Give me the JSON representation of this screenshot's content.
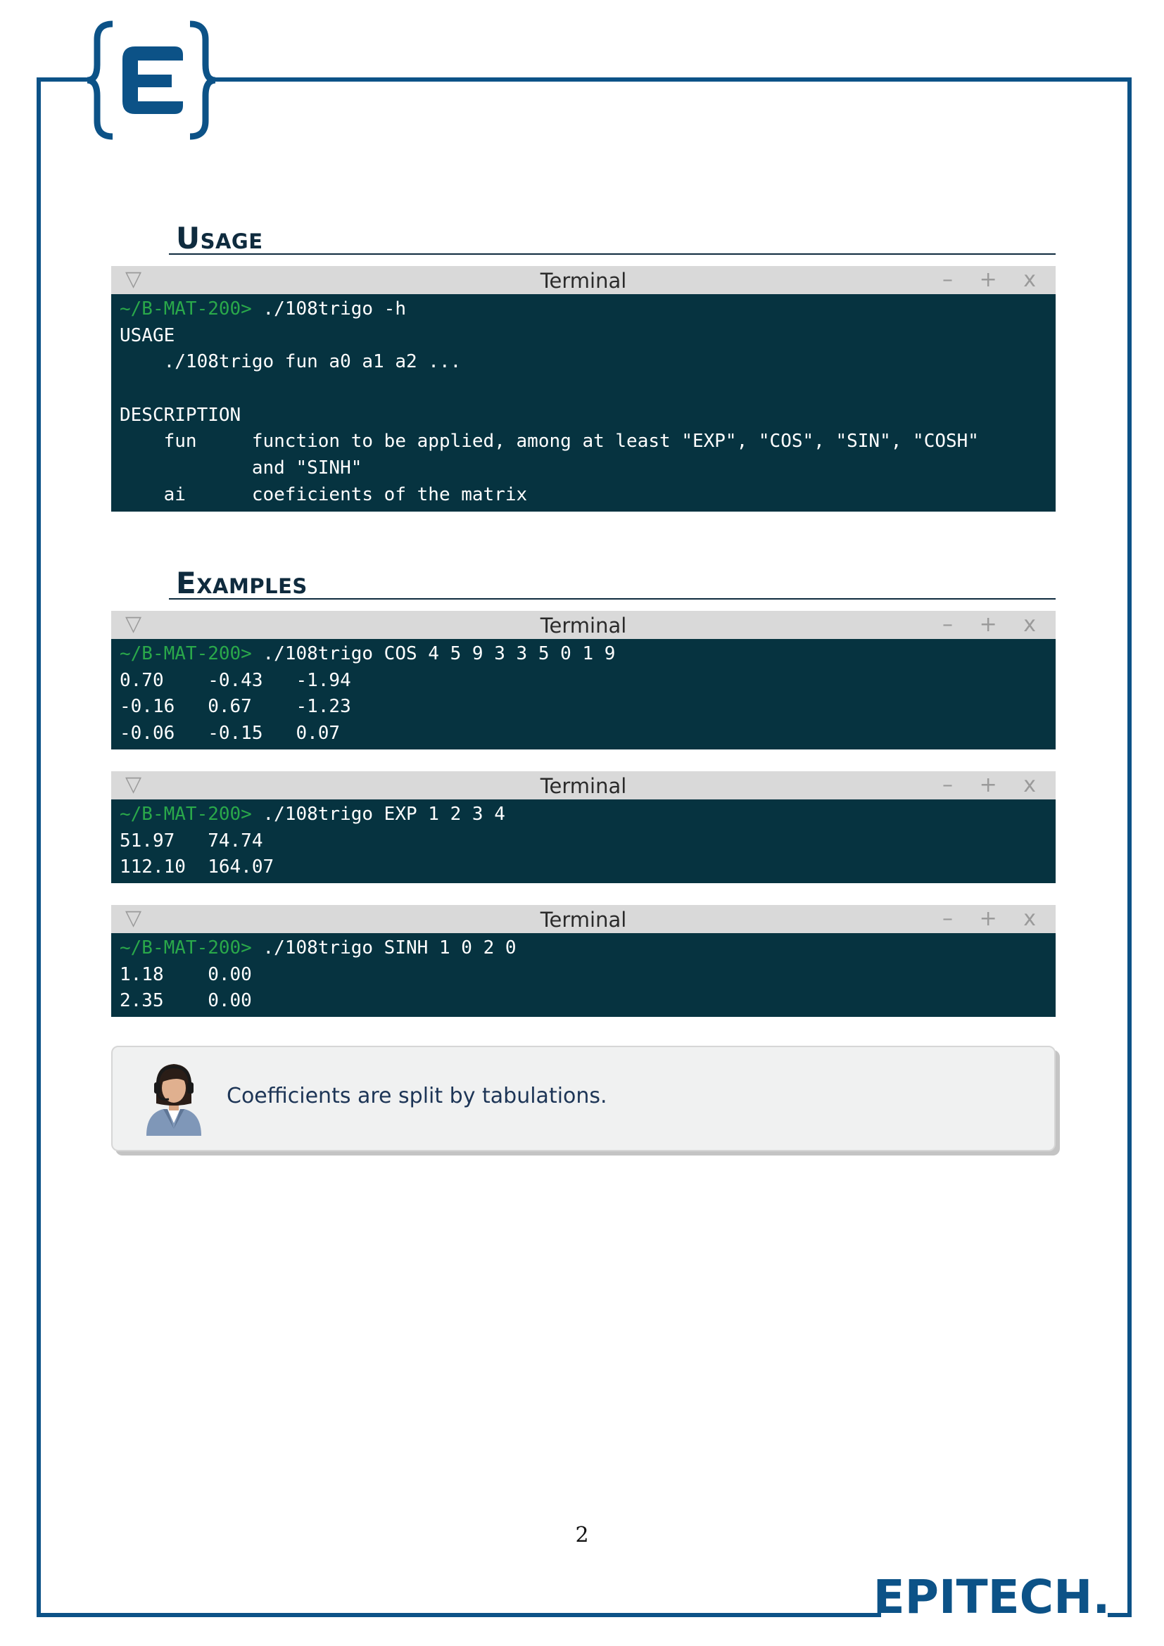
{
  "sections": {
    "usage_title": "Usage",
    "examples_title": "Examples"
  },
  "terminal_chrome": {
    "title": "Terminal",
    "collapse_glyph": "▽",
    "controls": "– + x"
  },
  "usage_terminal": {
    "lines": [
      {
        "prompt": "~/B-MAT-200>",
        "text": " ./108trigo -h"
      },
      {
        "prompt": "",
        "text": "USAGE"
      },
      {
        "prompt": "",
        "text": "    ./108trigo fun a0 a1 a2 ..."
      },
      {
        "prompt": "",
        "text": " "
      },
      {
        "prompt": "",
        "text": "DESCRIPTION"
      },
      {
        "prompt": "",
        "text": "    fun     function to be applied, among at least \"EXP\", \"COS\", \"SIN\", \"COSH\""
      },
      {
        "prompt": "",
        "text": "            and \"SINH\""
      },
      {
        "prompt": "",
        "text": "    ai      coeficients of the matrix"
      }
    ]
  },
  "example_terminals": [
    {
      "lines": [
        {
          "prompt": "~/B-MAT-200>",
          "text": " ./108trigo COS 4 5 9 3 3 5 0 1 9"
        },
        {
          "prompt": "",
          "text": "0.70    -0.43   -1.94"
        },
        {
          "prompt": "",
          "text": "-0.16   0.67    -1.23"
        },
        {
          "prompt": "",
          "text": "-0.06   -0.15   0.07"
        }
      ]
    },
    {
      "lines": [
        {
          "prompt": "~/B-MAT-200>",
          "text": " ./108trigo EXP 1 2 3 4"
        },
        {
          "prompt": "",
          "text": "51.97   74.74"
        },
        {
          "prompt": "",
          "text": "112.10  164.07"
        }
      ]
    },
    {
      "lines": [
        {
          "prompt": "~/B-MAT-200>",
          "text": " ./108trigo SINH 1 0 2 0"
        },
        {
          "prompt": "",
          "text": "1.18    0.00"
        },
        {
          "prompt": "",
          "text": "2.35    0.00"
        }
      ]
    }
  ],
  "note": {
    "text": "Coefficients are split by tabulations."
  },
  "footer": {
    "page_number": "2",
    "brand": "{EPITECH.}"
  },
  "colors": {
    "frame": "#0c5287",
    "terminal_bg": "#063340",
    "prompt": "#2aa84a",
    "heading": "#0f2b3e"
  },
  "icons": {
    "top_logo": "epitech-e-logo",
    "note_avatar": "support-agent-avatar"
  }
}
